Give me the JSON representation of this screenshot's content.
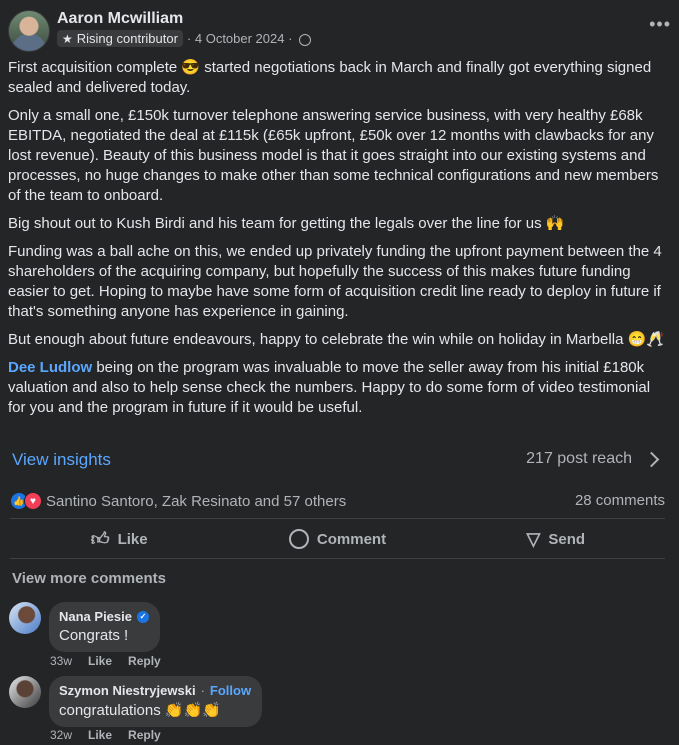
{
  "post": {
    "author": "Aaron Mcwilliam",
    "badge": "Rising contributor",
    "date": "· 4 October 2024 ·",
    "paragraphs": [
      "First acquisition complete 😎 started negotiations back in March and finally got everything signed sealed and delivered today.",
      "Only a small one, £150k turnover telephone answering service business, with very healthy £68k EBITDA, negotiated the deal at £115k (£65k upfront, £50k over 12 months with clawbacks for any lost revenue). Beauty of this business model is that it goes straight into our existing systems and processes, no huge changes to make other than some technical configurations and new members of the team to onboard.",
      "Big shout out to Kush Birdi and his team for getting the legals over the line for us 🙌",
      "Funding was a ball ache on this, we ended up privately funding the upfront payment between the 4 shareholders of the acquiring company, but hopefully the success of this makes future funding easier to get. Hoping to maybe have some form of acquisition credit line ready to deploy in future if that's something anyone has experience in gaining.",
      "But enough about future endeavours, happy to celebrate the win while on holiday in Marbella 😁🥂"
    ],
    "mention": "Dee Ludlow",
    "mention_text": " being on the program was invaluable to move the seller away from his initial £180k valuation and also to help sense check the numbers. Happy to do some form of video testimonial for you and the program in future if it would be useful."
  },
  "insights": {
    "label": "View insights",
    "reach": "217 post reach"
  },
  "reactions": {
    "summary": "Santino Santoro, Zak Resinato and 57 others",
    "comments": "28 comments"
  },
  "actions": {
    "like": "Like",
    "comment": "Comment",
    "send": "Send"
  },
  "comments": {
    "view_more": "View more comments",
    "items": [
      {
        "name": "Nana Piesie",
        "text": "Congrats !",
        "time": "33w",
        "like": "Like",
        "reply": "Reply"
      },
      {
        "name": "Szymon Niestryjewski",
        "follow": "Follow",
        "text": "congratulations 👏👏👏",
        "time": "32w",
        "like": "Like",
        "reply": "Reply"
      }
    ]
  },
  "icons": [
    "star-icon",
    "globe-icon",
    "more-icon",
    "chevron-right-icon",
    "like-reaction-icon",
    "love-reaction-icon",
    "thumbs-up-icon",
    "comment-icon",
    "send-icon",
    "verified-icon"
  ],
  "colors": {
    "background": "#242526",
    "link": "#5aa7ff",
    "text": "#e4e6eb",
    "muted": "#b0b3b8"
  }
}
